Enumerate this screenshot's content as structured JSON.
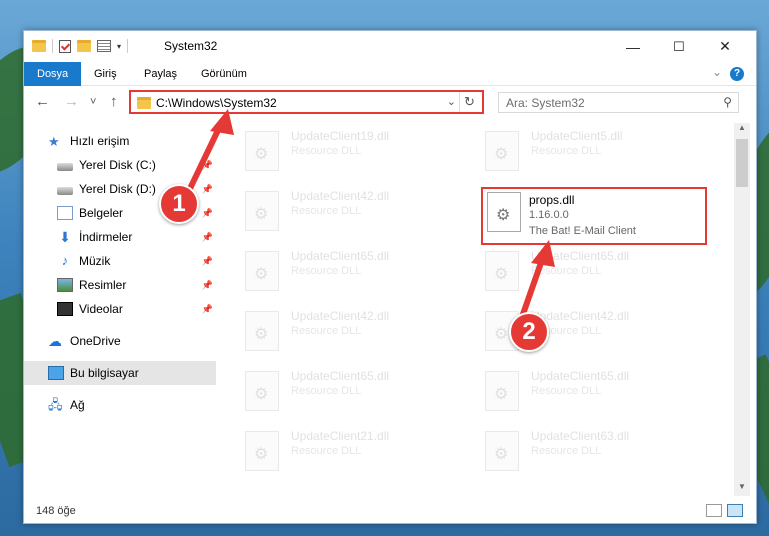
{
  "window": {
    "title": "System32"
  },
  "titlebar_icons": [
    "folder-icon",
    "properties-check-icon",
    "folder-icon",
    "properties-icon"
  ],
  "controls": {
    "minimize": "—",
    "maximize": "☐",
    "close": "✕"
  },
  "ribbon": {
    "tabs": [
      {
        "label": "Dosya",
        "active": true
      },
      {
        "label": "Giriş"
      },
      {
        "label": "Paylaş"
      },
      {
        "label": "Görünüm"
      }
    ],
    "help": "?"
  },
  "nav": {
    "back": "←",
    "forward": "→",
    "recent": "˅",
    "up": "↑",
    "address": "C:\\Windows\\System32",
    "search_placeholder": "Ara: System32"
  },
  "sidebar": {
    "items": [
      {
        "label": "Hızlı erişim",
        "icon": "star-icon"
      },
      {
        "label": "Yerel Disk (C:)",
        "icon": "drive-icon",
        "pinned": true
      },
      {
        "label": "Yerel Disk (D:)",
        "icon": "drive-icon",
        "pinned": true
      },
      {
        "label": "Belgeler",
        "icon": "documents-icon",
        "pinned": true
      },
      {
        "label": "İndirmeler",
        "icon": "downloads-icon",
        "pinned": true
      },
      {
        "label": "Müzik",
        "icon": "music-icon",
        "pinned": true
      },
      {
        "label": "Resimler",
        "icon": "pictures-icon",
        "pinned": true
      },
      {
        "label": "Videolar",
        "icon": "videos-icon",
        "pinned": true
      },
      {
        "label": "OneDrive",
        "icon": "onedrive-icon"
      },
      {
        "label": "Bu bilgisayar",
        "icon": "this-pc-icon",
        "selected": true
      },
      {
        "label": "Ağ",
        "icon": "network-icon"
      }
    ]
  },
  "files": {
    "left": [
      {
        "name": "UpdateClient19.dll",
        "desc": "Resource DLL"
      },
      {
        "name": "UpdateClient42.dll",
        "desc": "Resource DLL"
      },
      {
        "name": "UpdateClient65.dll",
        "desc": "Resource DLL"
      },
      {
        "name": "UpdateClient42.dll",
        "desc": "Resource DLL"
      },
      {
        "name": "UpdateClient65.dll",
        "desc": "Resource DLL"
      },
      {
        "name": "UpdateClient21.dll",
        "desc": "Resource DLL"
      }
    ],
    "right": [
      {
        "name": "UpdateClient5.dll",
        "desc": "Resource DLL"
      },
      {
        "name": "UpdateClient65.dll",
        "desc": "Resource DLL"
      },
      {
        "name": "UpdateClient42.dll",
        "desc": "Resource DLL"
      },
      {
        "name": "UpdateClient65.dll",
        "desc": "Resource DLL"
      },
      {
        "name": "UpdateClient63.dll",
        "desc": "Resource DLL"
      }
    ],
    "highlighted": {
      "name": "props.dll",
      "version": "1.16.0.0",
      "desc": "The Bat! E-Mail Client"
    }
  },
  "status": {
    "count": "148 öğe"
  },
  "callouts": {
    "one": "1",
    "two": "2"
  },
  "accent_color": "#1979ca",
  "highlight_color": "#e53935"
}
